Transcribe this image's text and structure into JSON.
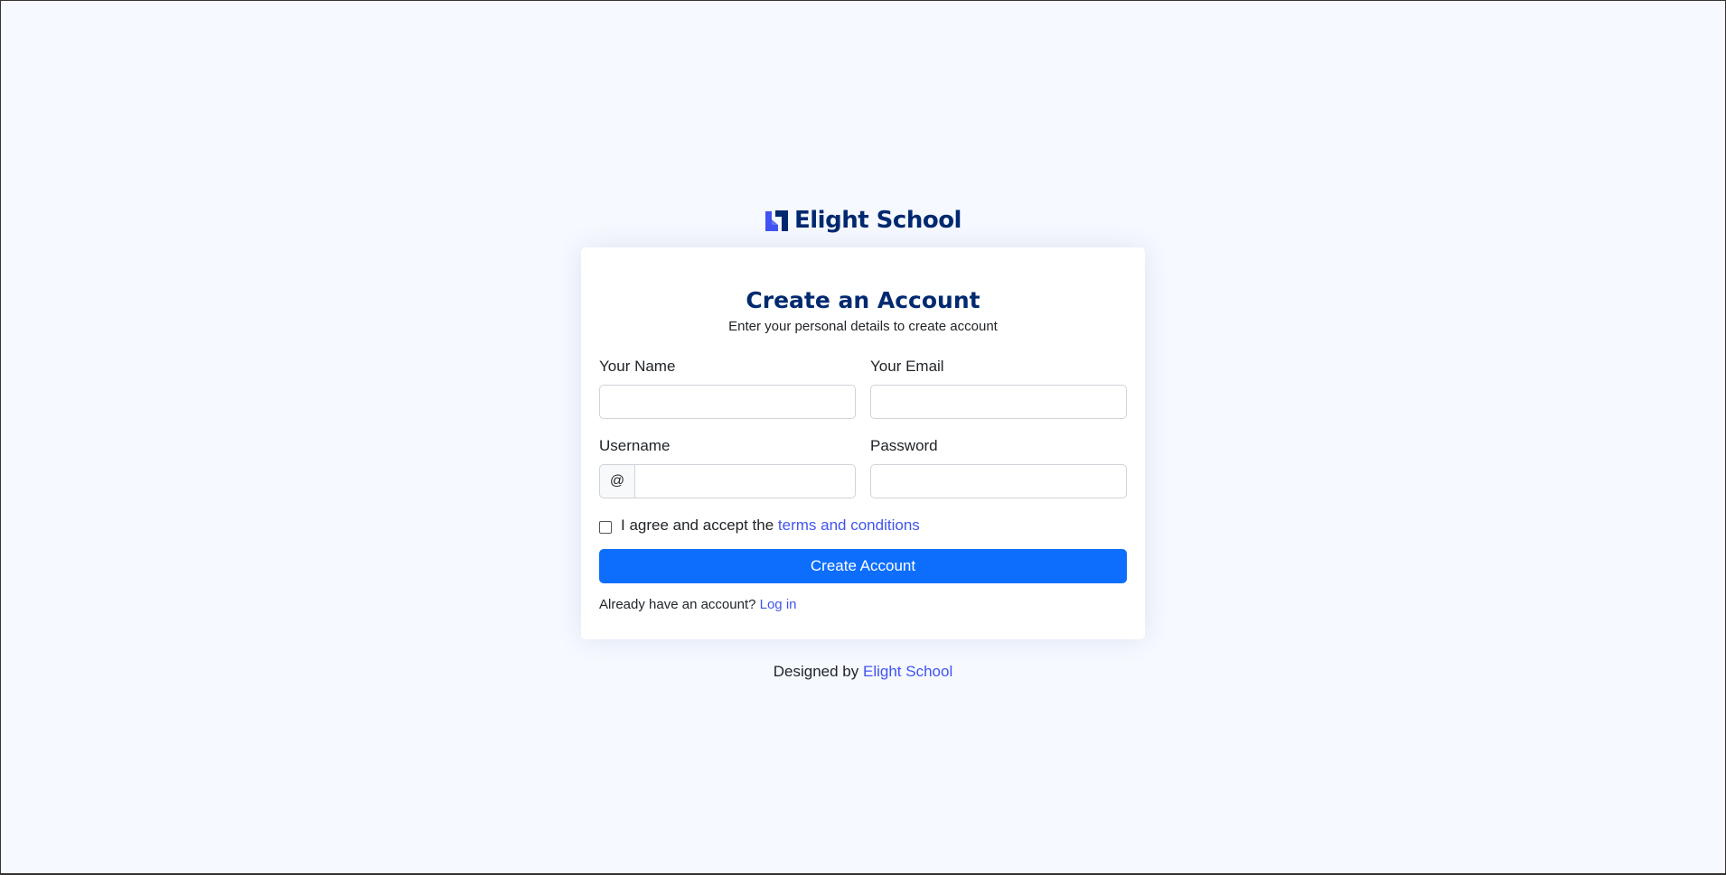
{
  "brand": {
    "name": "Elight School",
    "logo_icon": "brand-logo-icon",
    "color": "#012970"
  },
  "form": {
    "title": "Create an Account",
    "subtitle": "Enter your personal details to create account",
    "name_label": "Your Name",
    "name_value": "",
    "email_label": "Your Email",
    "email_value": "",
    "username_label": "Username",
    "username_prefix": "@",
    "username_value": "",
    "password_label": "Password",
    "password_value": "",
    "terms_text": "I agree and accept the",
    "terms_link": "terms and conditions",
    "terms_checked": false,
    "submit_label": "Create Account",
    "login_prompt": "Already have an account?",
    "login_link": "Log in"
  },
  "footer": {
    "designed_by": "Designed by",
    "designer_link": "Elight School"
  },
  "colors": {
    "background": "#f6f9ff",
    "primary": "#0d6efd",
    "link": "#4154f1",
    "heading": "#012970"
  }
}
